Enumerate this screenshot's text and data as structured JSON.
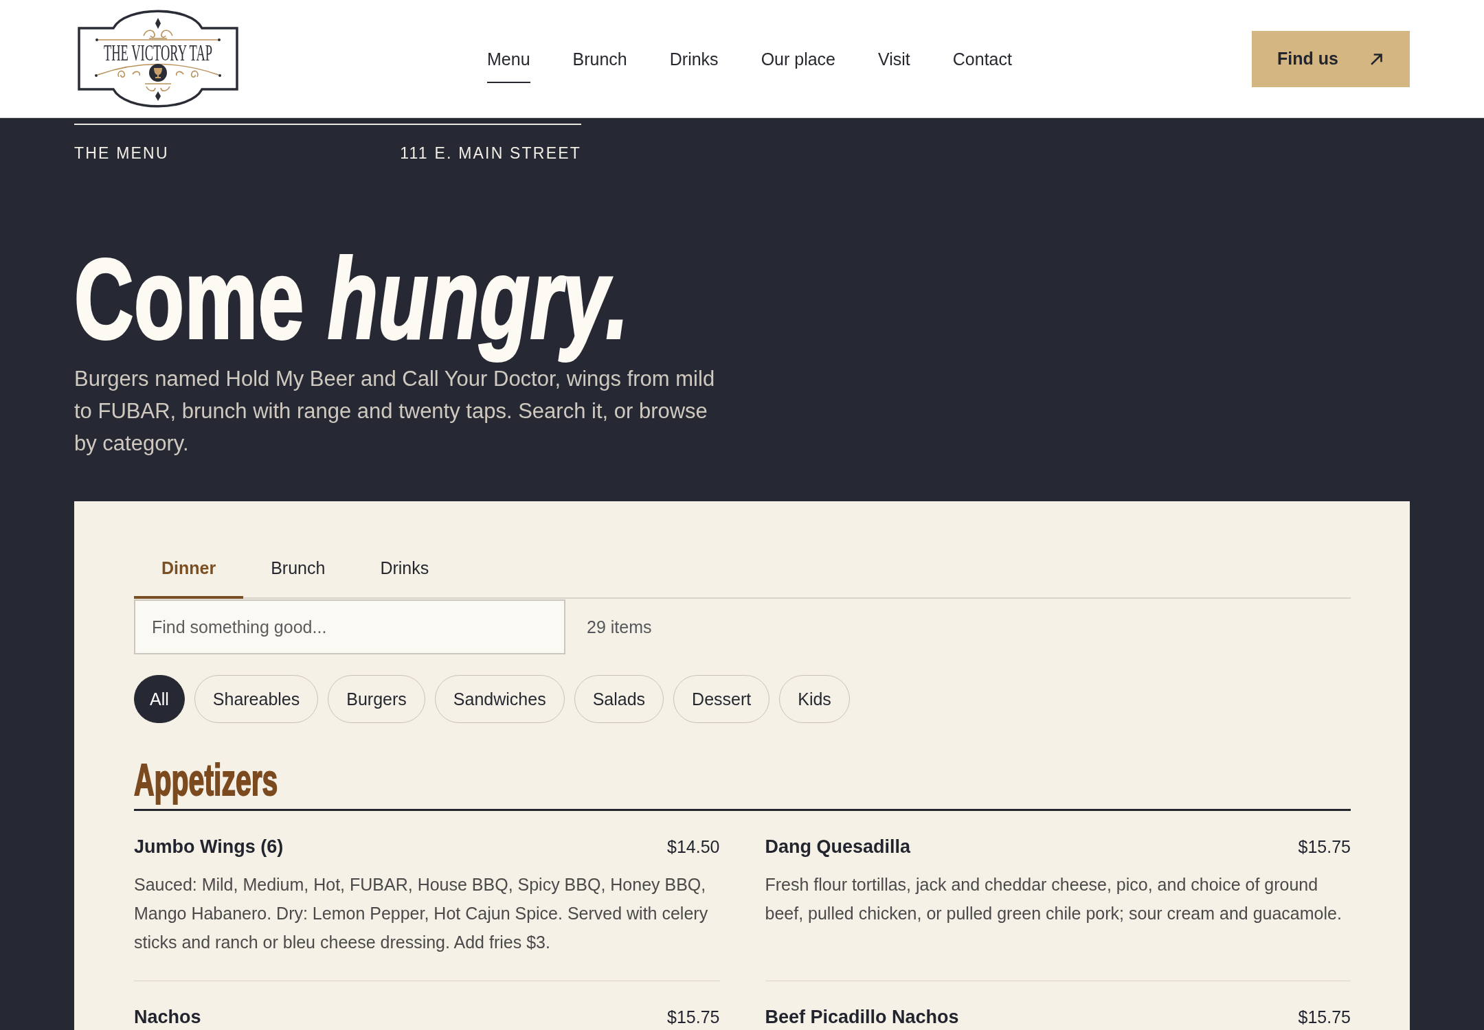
{
  "header": {
    "logo_text": "THE VICTORY TAP",
    "nav": [
      {
        "label": "Menu",
        "selected": true
      },
      {
        "label": "Brunch",
        "selected": false
      },
      {
        "label": "Drinks",
        "selected": false
      },
      {
        "label": "Our place",
        "selected": false
      },
      {
        "label": "Visit",
        "selected": false
      },
      {
        "label": "Contact",
        "selected": false
      }
    ],
    "cta": {
      "label": "Find us"
    }
  },
  "hero": {
    "section_label": "THE MENU",
    "address": "111 E. MAIN STREET",
    "headline": "Come *hungry.*",
    "intro": "Burgers named Hold My Beer and Call Your Doctor, wings from mild to FUBAR, brunch with range and twenty taps. Search it, or browse by category."
  },
  "menu_panel": {
    "tabs": [
      {
        "label": "Dinner",
        "selected": true
      },
      {
        "label": "Brunch",
        "selected": false
      },
      {
        "label": "Drinks",
        "selected": false
      }
    ],
    "search": {
      "placeholder": "Find something good..."
    },
    "item_count": "29 items",
    "filters": [
      {
        "label": "All",
        "selected": true
      },
      {
        "label": "Shareables",
        "selected": false
      },
      {
        "label": "Burgers",
        "selected": false
      },
      {
        "label": "Sandwiches",
        "selected": false
      },
      {
        "label": "Salads",
        "selected": false
      },
      {
        "label": "Dessert",
        "selected": false
      },
      {
        "label": "Kids",
        "selected": false
      }
    ],
    "sections": [
      {
        "title": "Appetizers",
        "items": [
          {
            "name": "Jumbo Wings (6)",
            "price": "$14.50",
            "description": "Sauced: Mild, Medium, Hot, FUBAR, House BBQ, Spicy BBQ, Honey BBQ, Mango Habanero. Dry: Lemon Pepper, Hot Cajun Spice. Served with celery sticks and ranch or bleu cheese dressing. Add fries $3."
          },
          {
            "name": "Dang Quesadilla",
            "price": "$15.75",
            "description": "Fresh flour tortillas, jack and cheddar cheese, pico, and choice of ground beef, pulled chicken, or pulled green chile pork; sour cream and guacamole."
          },
          {
            "name": "Nachos",
            "price": "$15.75"
          },
          {
            "name": "Beef Picadillo Nachos",
            "price": "$15.75"
          }
        ]
      }
    ]
  }
}
